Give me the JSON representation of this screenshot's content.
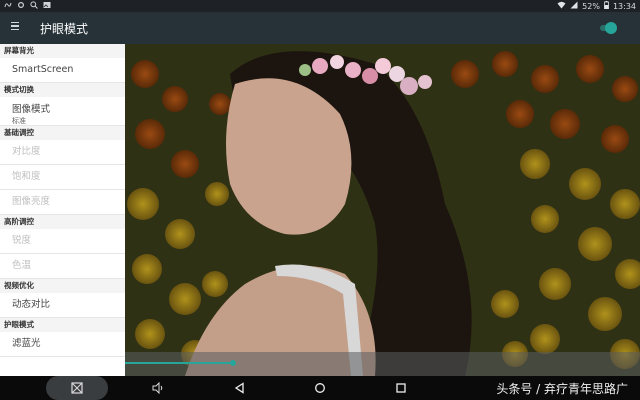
{
  "status_bar": {
    "battery": "52%",
    "time": "13:34",
    "left_icons": [
      "app-notify-icon",
      "settings-icon",
      "search-icon",
      "image-icon"
    ],
    "right_icons": [
      "wifi-icon",
      "signal-icon",
      "battery-icon"
    ]
  },
  "app_bar": {
    "title": "护眼模式",
    "toggle_on": true
  },
  "sidebar": {
    "sec_backlight": "屏幕背光",
    "smartscreen": "SmartScreen",
    "sec_mode": "模式切换",
    "image_mode": "图像模式",
    "image_mode_value": "标准",
    "sec_basic": "基础调控",
    "contrast": "对比度",
    "saturation": "饱和度",
    "brightness": "图像亮度",
    "sec_advanced": "高阶调控",
    "sharpness": "锐度",
    "color_temp": "色温",
    "sec_video": "视频优化",
    "dynamic_contrast": "动态对比",
    "sec_eye": "护眼模式",
    "blue_filter": "滤蓝光"
  },
  "preview": {
    "progress": 0.21
  },
  "nav_bar": {
    "icons": [
      "screenshot-icon",
      "volume-icon",
      "back-icon",
      "home-icon",
      "recents-icon"
    ]
  },
  "watermark": "头条号 / 弃疗青年思路广",
  "colors": {
    "accent": "#26a69a",
    "appbar": "#263238",
    "statusbar": "#1e2226"
  }
}
